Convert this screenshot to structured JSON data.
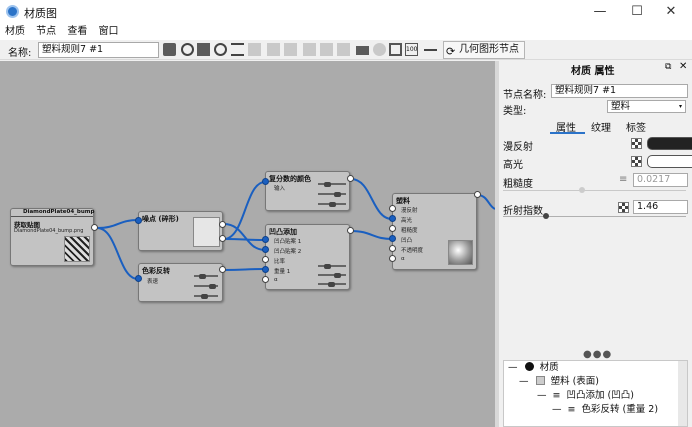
{
  "window": {
    "title": "材质图"
  },
  "menu": [
    "材质",
    "节点",
    "查看",
    "窗口"
  ],
  "toolbar": {
    "name_label": "名称:",
    "name_value": "塑料规则7 #1",
    "geometry_button": "几何图形节点"
  },
  "nodes": {
    "diamond": {
      "title": "DiamondPlate04_bump",
      "label": "获取贴图",
      "file": "DiamondPlate04_bump.png"
    },
    "noise": {
      "title": "噪点 (碎形)"
    },
    "color_invert": {
      "title": "色彩反转",
      "input": "表速"
    },
    "complex_color": {
      "title": "复分数的颜色",
      "input": "输入"
    },
    "bump_add": {
      "title": "凹凸添加",
      "inputs": [
        "凹凸贴案 1",
        "凹凸贴案 2",
        "比率",
        "重量 1",
        "α"
      ]
    },
    "plastic": {
      "title": "塑料",
      "inputs": [
        "漫反射",
        "高光",
        "粗糙度",
        "凹凸",
        "不透明度",
        "α"
      ]
    }
  },
  "panel": {
    "header": "材质 属性",
    "node_name_label": "节点名称:",
    "node_name_value": "塑料规则7 #1",
    "type_label": "类型:",
    "type_value": "塑料",
    "tabs": [
      "属性",
      "纹理",
      "标签"
    ],
    "props": {
      "diffuse": "漫反射",
      "specular": "高光",
      "roughness": "粗糙度",
      "roughness_value": "0.0217",
      "ior": "折射指数",
      "ior_value": "1.46"
    },
    "tree": [
      "材质",
      "塑料 (表面)",
      "凹凸添加 (凹凸)",
      "色彩反转 (重量 2)"
    ]
  },
  "colors": {
    "wire": "#1a5fc0",
    "canvas": "#ababab",
    "node": "#c3c3c3",
    "accent": "#2b73c8"
  }
}
